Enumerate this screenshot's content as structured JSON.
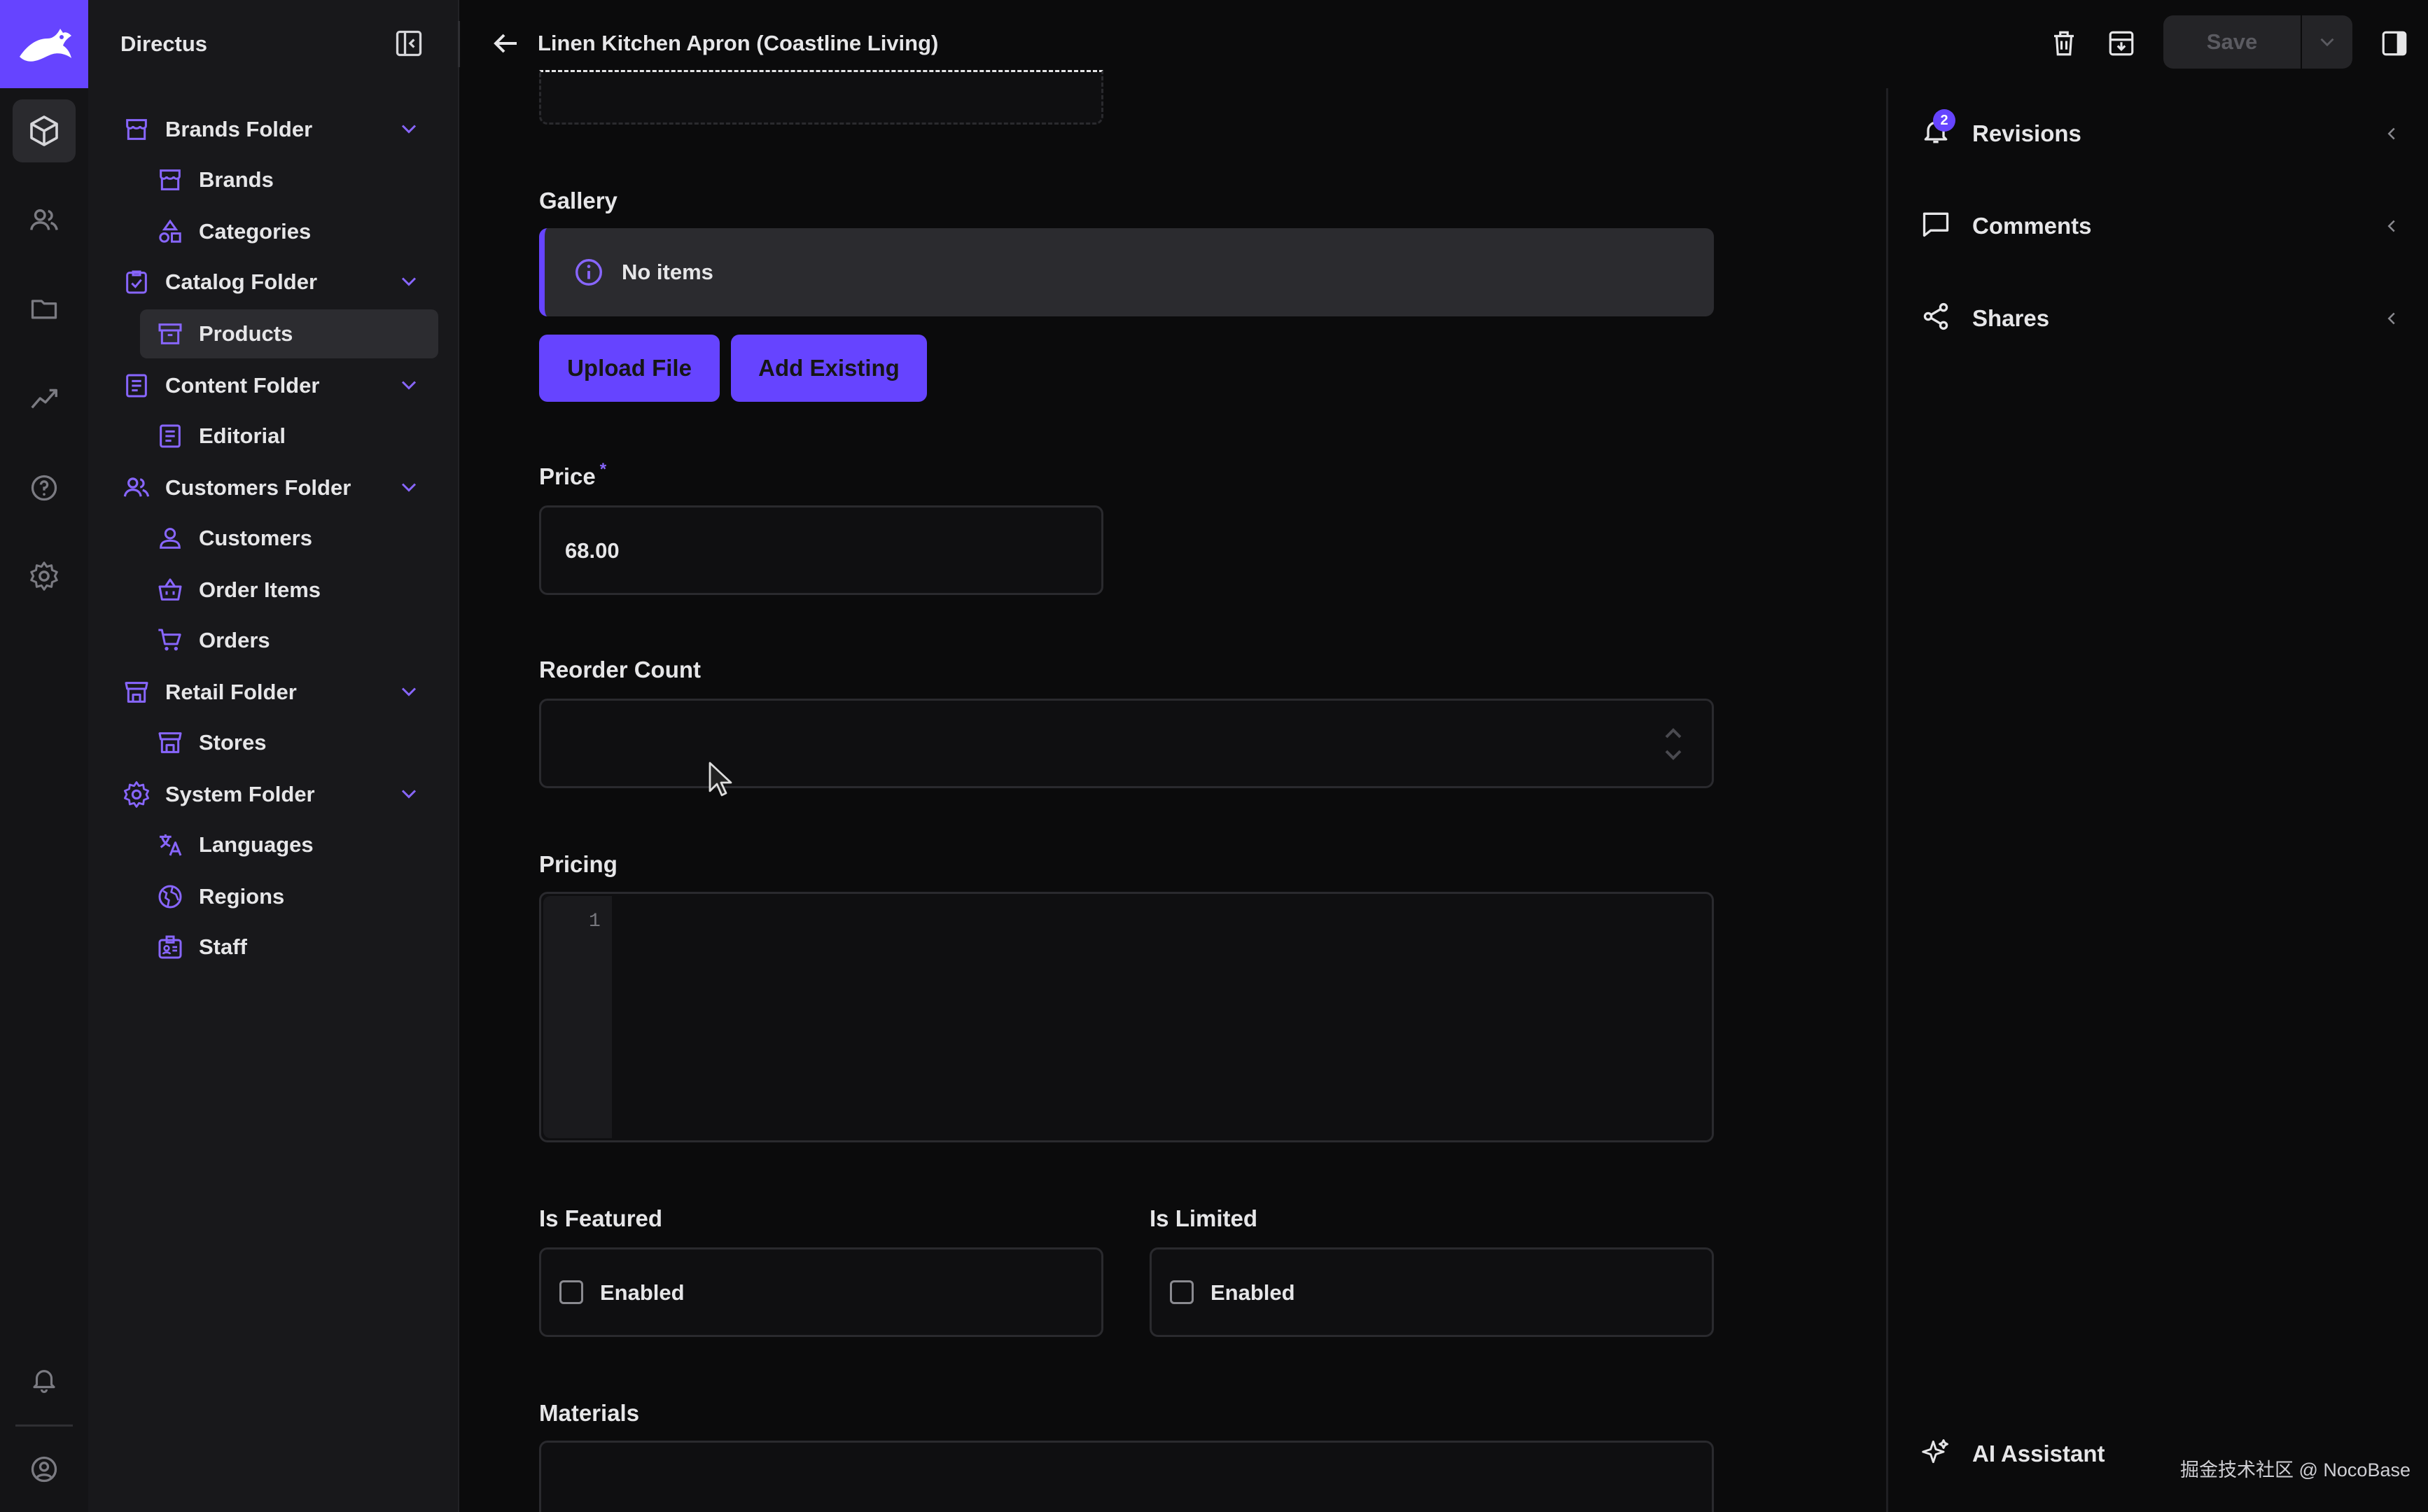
{
  "app": {
    "name": "Directus"
  },
  "header": {
    "title": "Linen Kitchen Apron (Coastline Living)",
    "save_label": "Save"
  },
  "navigation": {
    "folders": [
      {
        "label": "Brands Folder",
        "items": [
          "Brands",
          "Categories"
        ]
      },
      {
        "label": "Catalog Folder",
        "items": [
          "Products"
        ]
      },
      {
        "label": "Content Folder",
        "items": [
          "Editorial"
        ]
      },
      {
        "label": "Customers Folder",
        "items": [
          "Customers",
          "Order Items",
          "Orders"
        ]
      },
      {
        "label": "Retail Folder",
        "items": [
          "Stores"
        ]
      },
      {
        "label": "System Folder",
        "items": [
          "Languages",
          "Regions",
          "Staff"
        ]
      }
    ],
    "active_item": "Products"
  },
  "form": {
    "gallery": {
      "label": "Gallery",
      "notice": "No items",
      "upload_label": "Upload File",
      "add_existing_label": "Add Existing"
    },
    "price": {
      "label": "Price",
      "required_mark": "*",
      "value": "68.00"
    },
    "reorder_count": {
      "label": "Reorder Count",
      "value": ""
    },
    "pricing": {
      "label": "Pricing",
      "line_number": "1"
    },
    "is_featured": {
      "label": "Is Featured",
      "option": "Enabled",
      "checked": false
    },
    "is_limited": {
      "label": "Is Limited",
      "option": "Enabled",
      "checked": false
    },
    "materials": {
      "label": "Materials"
    }
  },
  "sidebar": {
    "revisions": {
      "label": "Revisions",
      "badge": "2"
    },
    "comments": {
      "label": "Comments"
    },
    "shares": {
      "label": "Shares"
    },
    "ai_assistant": {
      "label": "AI Assistant"
    }
  },
  "watermark": "掘金技术社区 @ NocoBase",
  "colors": {
    "accent": "#6644ff",
    "background": "#0b0b0c",
    "nav_background": "#18181b",
    "rail_background": "#141416"
  }
}
